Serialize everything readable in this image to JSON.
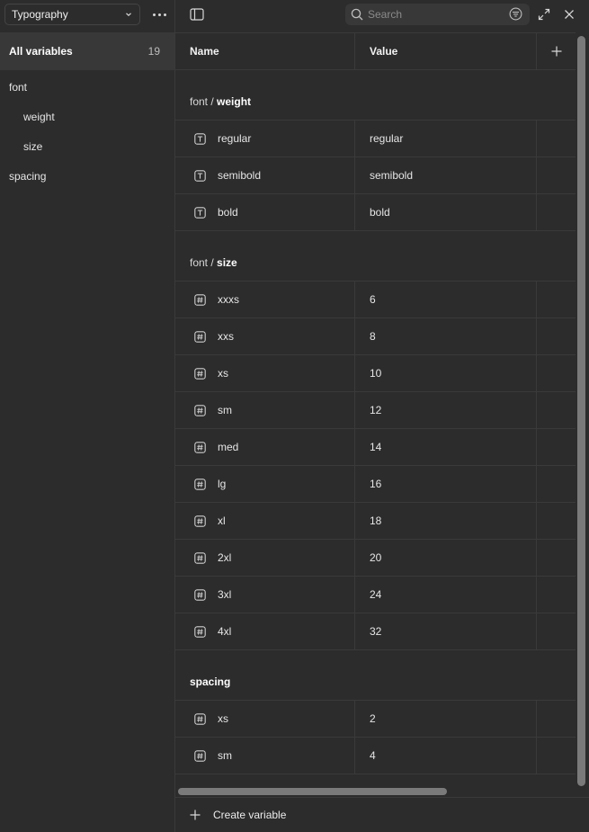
{
  "collection": {
    "name": "Typography"
  },
  "sidebar": {
    "all_label": "All variables",
    "all_count": "19",
    "groups": [
      {
        "label": "font"
      },
      {
        "label": "weight"
      },
      {
        "label": "size"
      },
      {
        "label": "spacing"
      }
    ]
  },
  "search": {
    "placeholder": "Search"
  },
  "table": {
    "col_name": "Name",
    "col_value": "Value",
    "sections": [
      {
        "prefix": "font / ",
        "title": "weight",
        "rows": [
          {
            "type": "string",
            "name": "regular",
            "value": "regular"
          },
          {
            "type": "string",
            "name": "semibold",
            "value": "semibold"
          },
          {
            "type": "string",
            "name": "bold",
            "value": "bold"
          }
        ]
      },
      {
        "prefix": "font / ",
        "title": "size",
        "rows": [
          {
            "type": "number",
            "name": "xxxs",
            "value": "6"
          },
          {
            "type": "number",
            "name": "xxs",
            "value": "8"
          },
          {
            "type": "number",
            "name": "xs",
            "value": "10"
          },
          {
            "type": "number",
            "name": "sm",
            "value": "12"
          },
          {
            "type": "number",
            "name": "med",
            "value": "14"
          },
          {
            "type": "number",
            "name": "lg",
            "value": "16"
          },
          {
            "type": "number",
            "name": "xl",
            "value": "18"
          },
          {
            "type": "number",
            "name": "2xl",
            "value": "20"
          },
          {
            "type": "number",
            "name": "3xl",
            "value": "24"
          },
          {
            "type": "number",
            "name": "4xl",
            "value": "32"
          }
        ]
      },
      {
        "prefix": "",
        "title": "spacing",
        "rows": [
          {
            "type": "number",
            "name": "xs",
            "value": "2"
          },
          {
            "type": "number",
            "name": "sm",
            "value": "4"
          }
        ]
      }
    ]
  },
  "footer": {
    "create_label": "Create variable"
  },
  "icons": {
    "string_type": "text-type-icon",
    "number_type": "number-type-icon"
  },
  "colors": {
    "background": "#2c2c2c",
    "selected": "#383838",
    "border": "#3a3a3a"
  }
}
